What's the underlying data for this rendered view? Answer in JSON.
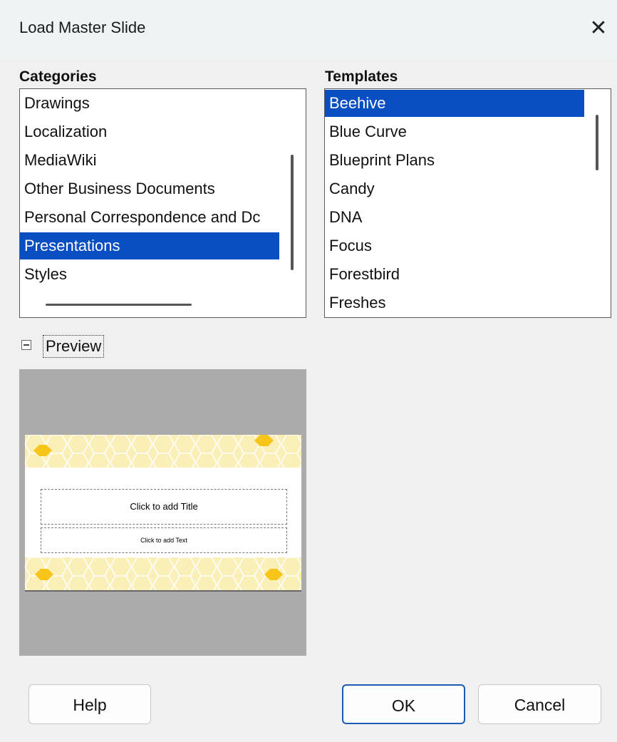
{
  "dialog": {
    "title": "Load Master Slide",
    "close_glyph": "✕",
    "close_icon": "close-icon"
  },
  "categories": {
    "header": "Categories",
    "items": [
      {
        "label": "Drawings",
        "selected": false
      },
      {
        "label": "Localization",
        "selected": false
      },
      {
        "label": "MediaWiki",
        "selected": false
      },
      {
        "label": "Other Business Documents",
        "selected": false
      },
      {
        "label": "Personal Correspondence and Dc",
        "selected": false
      },
      {
        "label": "Presentations",
        "selected": true
      },
      {
        "label": "Styles",
        "selected": false
      }
    ]
  },
  "templates": {
    "header": "Templates",
    "items": [
      {
        "label": "Beehive",
        "selected": true
      },
      {
        "label": "Blue Curve",
        "selected": false
      },
      {
        "label": "Blueprint Plans",
        "selected": false
      },
      {
        "label": "Candy",
        "selected": false
      },
      {
        "label": "DNA",
        "selected": false
      },
      {
        "label": "Focus",
        "selected": false
      },
      {
        "label": "Forestbird",
        "selected": false
      },
      {
        "label": "Freshes",
        "selected": false
      }
    ]
  },
  "preview": {
    "label": "Preview",
    "expanded": true,
    "expander_icon": "collapse-icon",
    "slide": {
      "title_placeholder": "Click to add Title",
      "text_placeholder": "Click to add Text"
    }
  },
  "buttons": {
    "help": "Help",
    "ok": "OK",
    "cancel": "Cancel"
  },
  "colors": {
    "selection": "#0a4fc2",
    "honeycomb": "#fbefb8",
    "honeycomb_stroke": "#ffffff",
    "honeycomb_accent": "#f7c41a",
    "preview_background": "#ababab"
  }
}
